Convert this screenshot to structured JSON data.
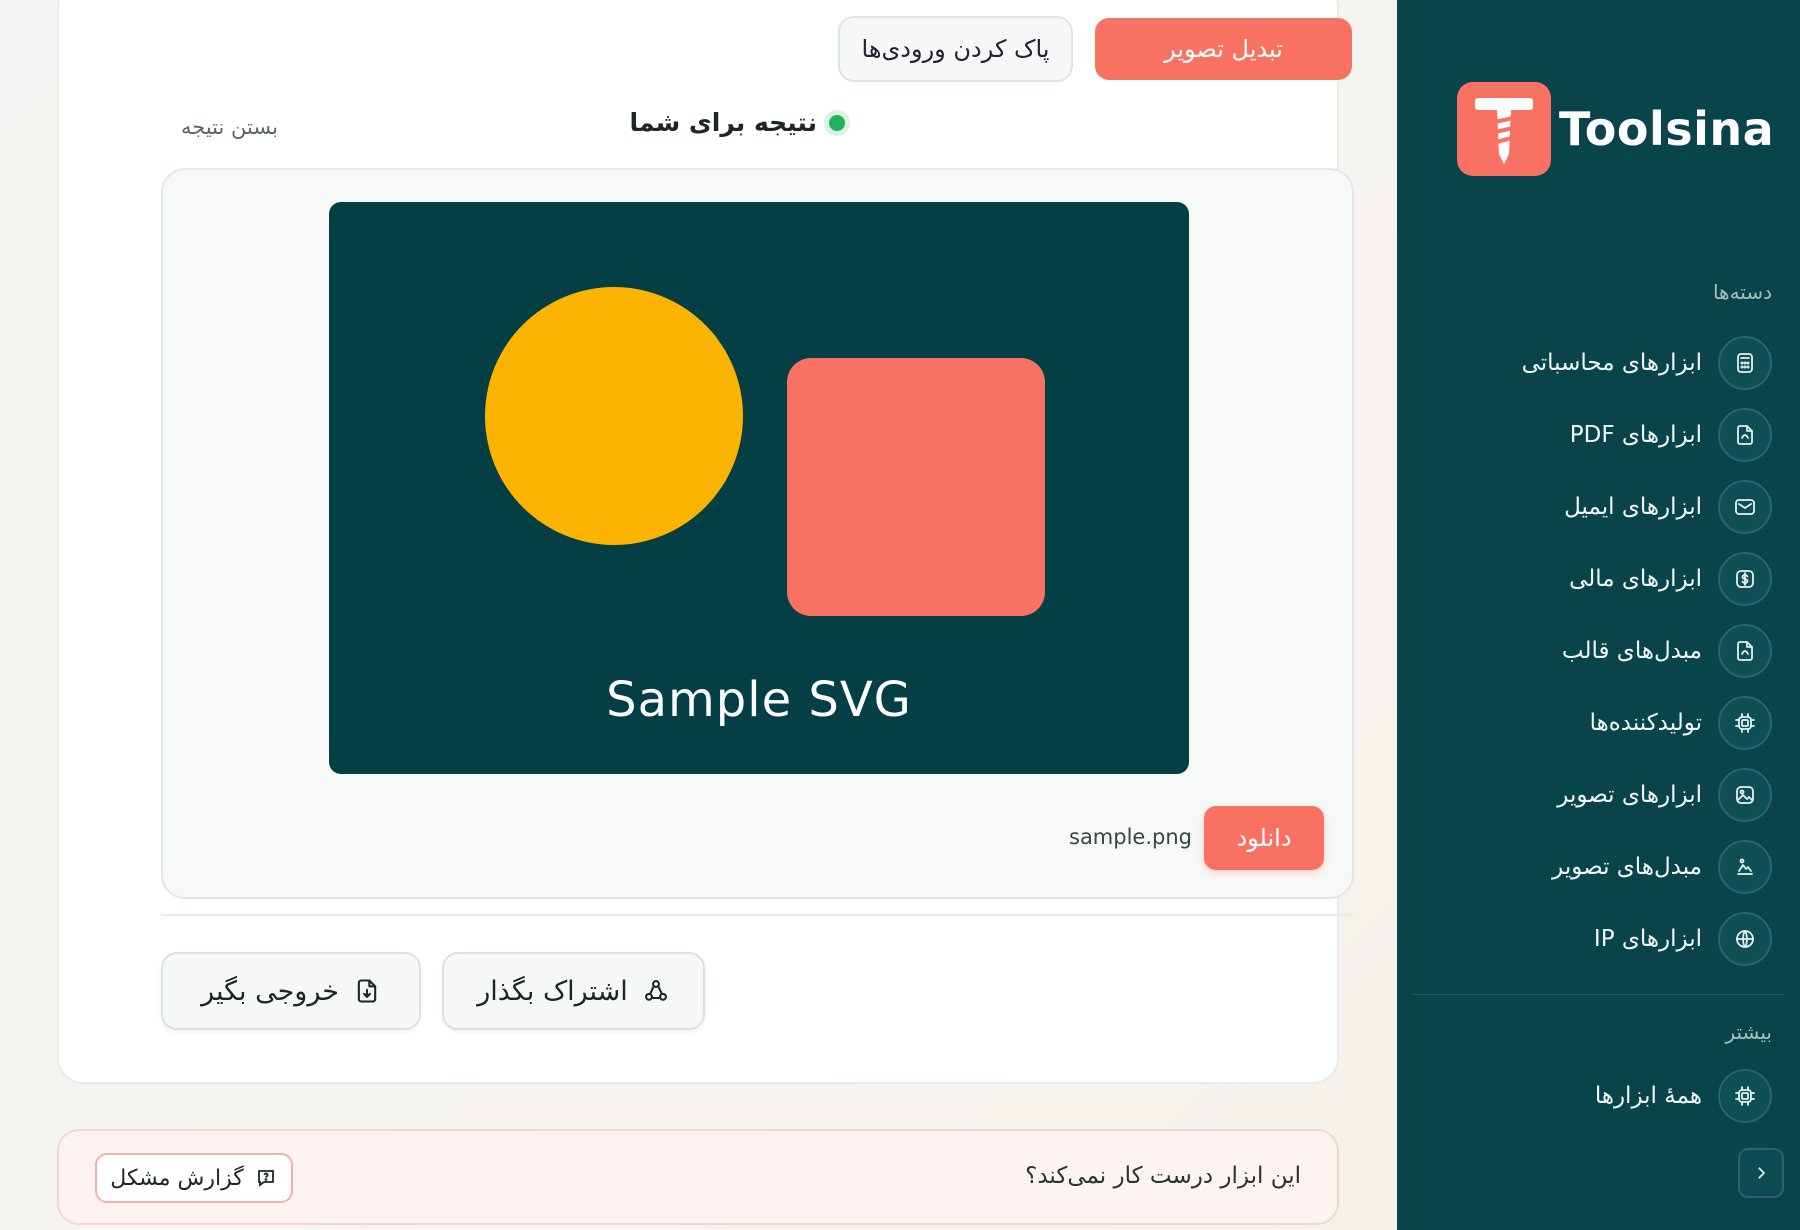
{
  "brand": {
    "name": "Toolsina",
    "accent": "#f87263",
    "sidebar_bg": "#08444a"
  },
  "sidebar": {
    "categories_title": "دسته‌ها",
    "items": [
      {
        "label": "ابزارهای محاسباتی",
        "icon": "calculator-icon"
      },
      {
        "label": "ابزارهای PDF",
        "icon": "pdf-file-icon"
      },
      {
        "label": "ابزارهای ایمیل",
        "icon": "mail-icon"
      },
      {
        "label": "ابزارهای مالی",
        "icon": "dollar-icon"
      },
      {
        "label": "مبدل‌های قالب",
        "icon": "file-convert-icon"
      },
      {
        "label": "تولیدکننده‌ها",
        "icon": "chip-icon"
      },
      {
        "label": "ابزارهای تصویر",
        "icon": "image-icon"
      },
      {
        "label": "مبدل‌های تصویر",
        "icon": "image-convert-icon"
      },
      {
        "label": "ابزارهای IP",
        "icon": "globe-icon"
      }
    ],
    "more_title": "بیشتر",
    "more_items": [
      {
        "label": "همهٔ ابزارها",
        "icon": "chip-icon"
      }
    ]
  },
  "actions": {
    "convert_label": "تبدیل تصویر",
    "clear_label": "پاک کردن ورودی‌ها"
  },
  "result": {
    "title": "نتیجه برای شما",
    "close_label": "بستن نتیجه",
    "preview_caption": "Sample SVG",
    "download_label": "دانلود",
    "filename": "sample.png",
    "colors": {
      "preview_bg": "#043f45",
      "circle": "#fdb400",
      "square": "#f87263"
    }
  },
  "output_buttons": {
    "export_label": "خروجی بگیر",
    "share_label": "اشتراک بگذار"
  },
  "report": {
    "question": "این ابزار درست کار نمی‌کند؟",
    "button_label": "گزارش مشکل"
  }
}
